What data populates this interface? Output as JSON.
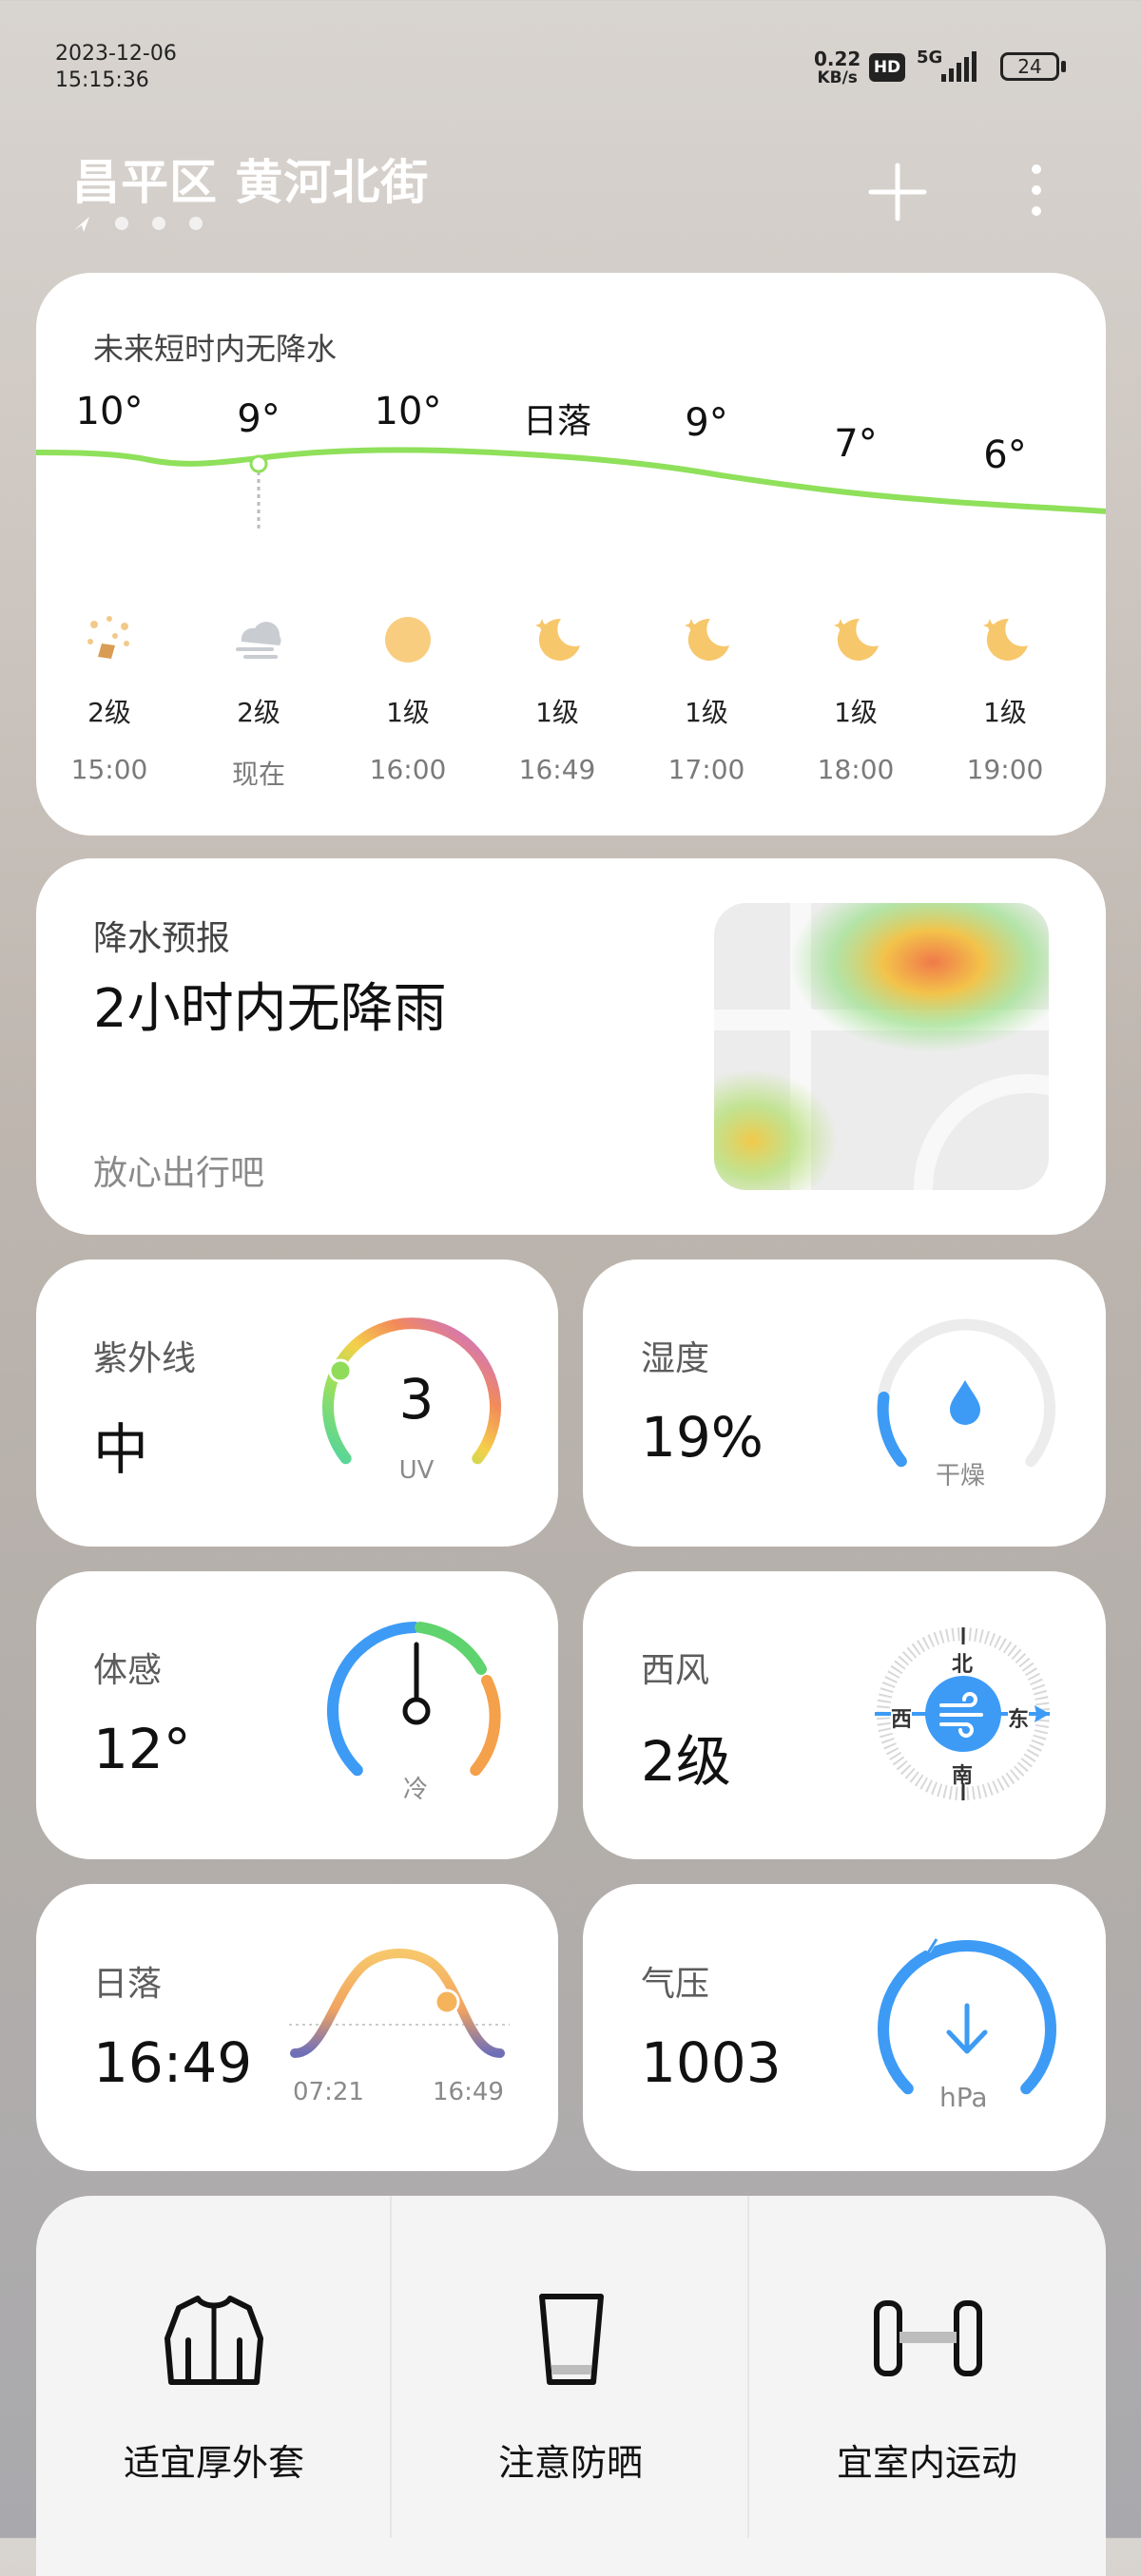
{
  "status": {
    "date": "2023-12-06",
    "time": "15:15:36",
    "net_speed_value": "0.22",
    "net_speed_unit": "KB/s",
    "hd": "HD",
    "network": "5G",
    "battery": "24"
  },
  "header": {
    "location": "昌平区 黄河北街",
    "add_icon": "plus-icon",
    "more_icon": "more-vertical-icon"
  },
  "hourly": {
    "notice": "未来短时内无降水",
    "items": [
      {
        "temp": "10°",
        "icon": "sand-dust-icon",
        "level": "2级",
        "time": "15:00"
      },
      {
        "temp": "9°",
        "icon": "haze-cloud-icon",
        "level": "2级",
        "time": "现在"
      },
      {
        "temp": "10°",
        "icon": "sun-icon",
        "level": "1级",
        "time": "16:00"
      },
      {
        "temp": "日落",
        "icon": "moon-icon",
        "level": "1级",
        "time": "16:49"
      },
      {
        "temp": "9°",
        "icon": "moon-icon",
        "level": "1级",
        "time": "17:00"
      },
      {
        "temp": "7°",
        "icon": "moon-icon",
        "level": "1级",
        "time": "18:00"
      },
      {
        "temp": "6°",
        "icon": "moon-icon",
        "level": "1级",
        "time": "19:00"
      }
    ]
  },
  "precip": {
    "title": "降水预报",
    "headline": "2小时内无降雨",
    "sub": "放心出行吧"
  },
  "uv": {
    "label": "紫外线",
    "value": "中",
    "index": "3",
    "unit": "UV",
    "level_fraction": 0.3
  },
  "humidity": {
    "label": "湿度",
    "value": "19%",
    "desc": "干燥",
    "level_fraction": 0.19
  },
  "feels": {
    "label": "体感",
    "value": "12°",
    "desc": "冷"
  },
  "wind": {
    "label": "西风",
    "value": "2级",
    "north": "北",
    "south": "南",
    "west": "西",
    "east": "东"
  },
  "sunset": {
    "label": "日落",
    "value": "16:49",
    "sunrise_time": "07:21",
    "sunset_time": "16:49"
  },
  "pressure": {
    "label": "气压",
    "value": "1003",
    "unit": "hPa"
  },
  "tips": [
    {
      "icon": "jacket-icon",
      "label": "适宜厚外套"
    },
    {
      "icon": "cup-icon",
      "label": "注意防晒"
    },
    {
      "icon": "dumbbell-icon",
      "label": "宜室内运动"
    }
  ],
  "colors": {
    "accent_blue": "#3d9bf5",
    "temp_line": "#8fe05a",
    "moon": "#f7c76b"
  }
}
